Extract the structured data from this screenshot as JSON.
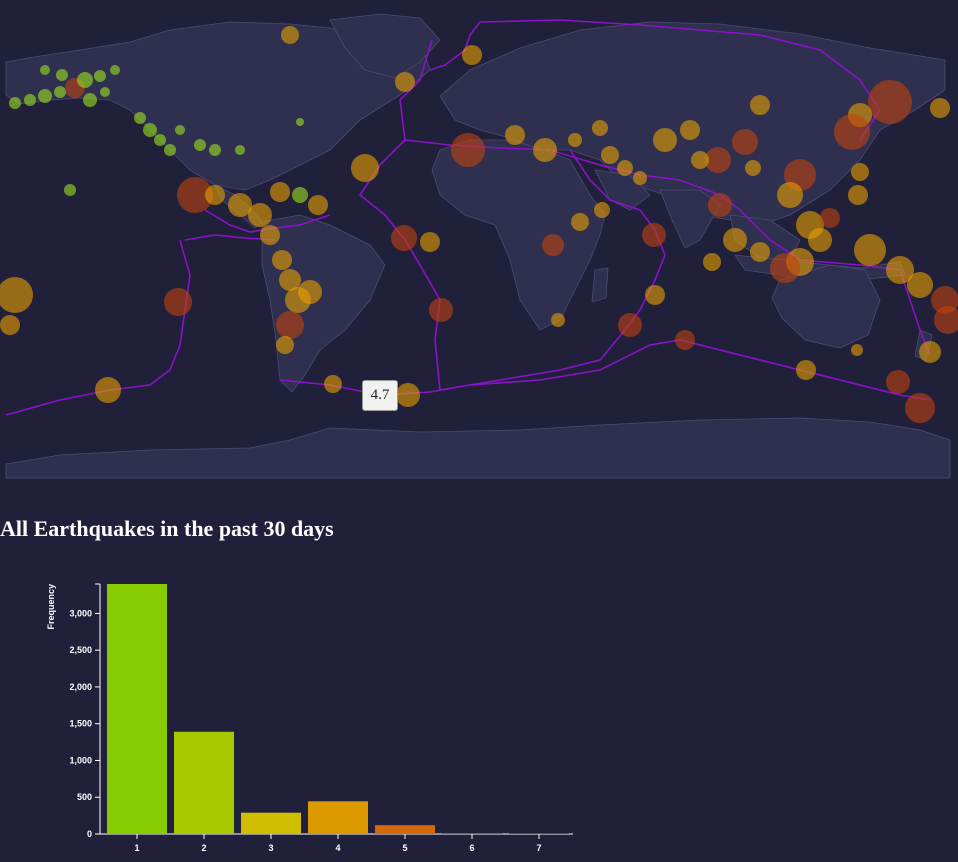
{
  "map": {
    "tooltip_value": "4.7",
    "colors": {
      "background": "#21203a",
      "land": "#2f3050",
      "land_border": "#4a4c72",
      "plate_boundary": "#8a12c8",
      "quake_low": "#9be21a",
      "quake_mid": "#e8a000",
      "quake_high": "#c0420e"
    }
  },
  "page_title": "All Earthquakes in the past 30 days",
  "chart_data": {
    "type": "bar",
    "title": "All Earthquakes in the past 30 days",
    "xlabel": "",
    "ylabel": "Frequency",
    "categories": [
      "1",
      "2",
      "3",
      "4",
      "5",
      "6",
      "7"
    ],
    "values": [
      3400,
      1390,
      290,
      445,
      120,
      8,
      1
    ],
    "ylim": [
      0,
      3400
    ],
    "yticks": [
      0,
      500,
      1000,
      1500,
      2000,
      2500,
      3000
    ],
    "ytick_labels": [
      "0",
      "500",
      "1,000",
      "1,500",
      "2,000",
      "2,500",
      "3,000"
    ],
    "grid": false,
    "bar_colors": [
      "#86cc00",
      "#a8c800",
      "#d2be00",
      "#dc9a00",
      "#d46a0a",
      "#c0420e",
      "#9e2e1a"
    ]
  }
}
